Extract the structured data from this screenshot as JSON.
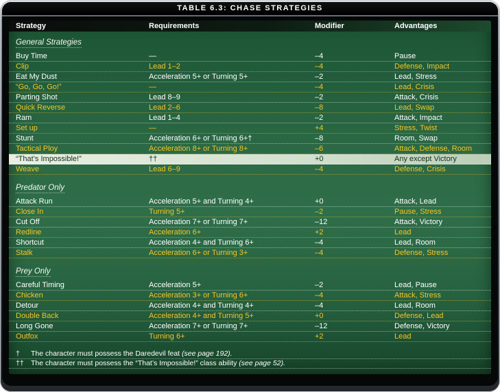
{
  "title": "TABLE 6.3: CHASE STRATEGIES",
  "columns": [
    "Strategy",
    "Requirements",
    "Modifier",
    "Advantages"
  ],
  "colors": {
    "gold_text": "#f5c527",
    "white_text": "#ffffff",
    "green_dark": "#164429",
    "green_mid": "#2e6e48",
    "highlight_bg": "#d9e4d5",
    "highlight_text": "#15301d",
    "frame_gray": "#5c6268",
    "titlebar_bg": "#000000"
  },
  "sections": [
    {
      "heading": "General Strategies",
      "rows": [
        {
          "strategy": "Buy Time",
          "requirements": "—",
          "modifier": "–4",
          "advantages": "Pause",
          "style": "white"
        },
        {
          "strategy": "Clip",
          "requirements": "Lead 1–2",
          "modifier": "–4",
          "advantages": "Defense, Impact",
          "style": "gold"
        },
        {
          "strategy": "Eat My Dust",
          "requirements": "Acceleration 5+ or Turning 5+",
          "modifier": "–2",
          "advantages": "Lead, Stress",
          "style": "white"
        },
        {
          "strategy": "“Go, Go, Go!”",
          "requirements": "—",
          "modifier": "–4",
          "advantages": "Lead, Crisis",
          "style": "gold"
        },
        {
          "strategy": "Parting Shot",
          "requirements": "Lead 8–9",
          "modifier": "–2",
          "advantages": "Attack, Crisis",
          "style": "white"
        },
        {
          "strategy": "Quick Reverse",
          "requirements": "Lead 2–6",
          "modifier": "–8",
          "advantages": "Lead, Swap",
          "style": "gold"
        },
        {
          "strategy": "Ram",
          "requirements": "Lead 1–4",
          "modifier": "–2",
          "advantages": "Attack, Impact",
          "style": "white"
        },
        {
          "strategy": "Set up",
          "requirements": "—",
          "modifier": "+4",
          "advantages": "Stress, Twist",
          "style": "gold"
        },
        {
          "strategy": "Stunt",
          "requirements": "Acceleration 6+ or Turning 6+†",
          "modifier": "–8",
          "advantages": "Room, Swap",
          "style": "white"
        },
        {
          "strategy": "Tactical Ploy",
          "requirements": "Acceleration 8+ or Turning 8+",
          "modifier": "–6",
          "advantages": "Attack, Defense, Room",
          "style": "gold"
        },
        {
          "strategy": "“That’s Impossible!”",
          "requirements": "††",
          "modifier": "+0",
          "advantages": "Any except Victory",
          "style": "highlight"
        },
        {
          "strategy": "Weave",
          "requirements": "Lead 6–9",
          "modifier": "–4",
          "advantages": "Defense, Crisis",
          "style": "gold"
        }
      ]
    },
    {
      "heading": "Predator Only",
      "rows": [
        {
          "strategy": "Attack Run",
          "requirements": "Acceleration 5+ and Turning 4+",
          "modifier": "+0",
          "advantages": "Attack, Lead",
          "style": "white"
        },
        {
          "strategy": "Close In",
          "requirements": "Turning 5+",
          "modifier": "–2",
          "advantages": "Pause, Stress",
          "style": "gold"
        },
        {
          "strategy": "Cut Off",
          "requirements": "Acceleration 7+ or Turning 7+",
          "modifier": "–12",
          "advantages": "Attack, Victory",
          "style": "white"
        },
        {
          "strategy": "Redline",
          "requirements": "Acceleration 6+",
          "modifier": "+2",
          "advantages": "Lead",
          "style": "gold"
        },
        {
          "strategy": "Shortcut",
          "requirements": "Acceleration 4+ and Turning 6+",
          "modifier": "–4",
          "advantages": "Lead, Room",
          "style": "white"
        },
        {
          "strategy": "Stalk",
          "requirements": "Acceleration 6+ or Turning 3+",
          "modifier": "–4",
          "advantages": "Defense, Stress",
          "style": "gold"
        }
      ]
    },
    {
      "heading": "Prey Only",
      "rows": [
        {
          "strategy": "Careful Timing",
          "requirements": "Acceleration 5+",
          "modifier": "–2",
          "advantages": "Lead, Pause",
          "style": "white"
        },
        {
          "strategy": "Chicken",
          "requirements": "Acceleration 3+ or Turning 6+",
          "modifier": "–4",
          "advantages": "Attack, Stress",
          "style": "gold"
        },
        {
          "strategy": "Detour",
          "requirements": "Acceleration 4+ and Turning 4+",
          "modifier": "–4",
          "advantages": "Lead, Room",
          "style": "white"
        },
        {
          "strategy": "Double Back",
          "requirements": "Acceleration 4+ and Turning 5+",
          "modifier": "+0",
          "advantages": "Defense, Lead",
          "style": "gold"
        },
        {
          "strategy": "Long Gone",
          "requirements": "Acceleration 7+ or Turning 7+",
          "modifier": "–12",
          "advantages": "Defense, Victory",
          "style": "white"
        },
        {
          "strategy": "Outfox",
          "requirements": "Turning 6+",
          "modifier": "+2",
          "advantages": "Lead",
          "style": "gold"
        }
      ]
    }
  ],
  "footnotes": [
    {
      "symbol": "†",
      "text": "The character must possess the Daredevil feat ",
      "cite": "(see page 192)."
    },
    {
      "symbol": "††",
      "text": "The character must possess the “That’s Impossible!” class ability ",
      "cite": "(see page 52)."
    }
  ]
}
